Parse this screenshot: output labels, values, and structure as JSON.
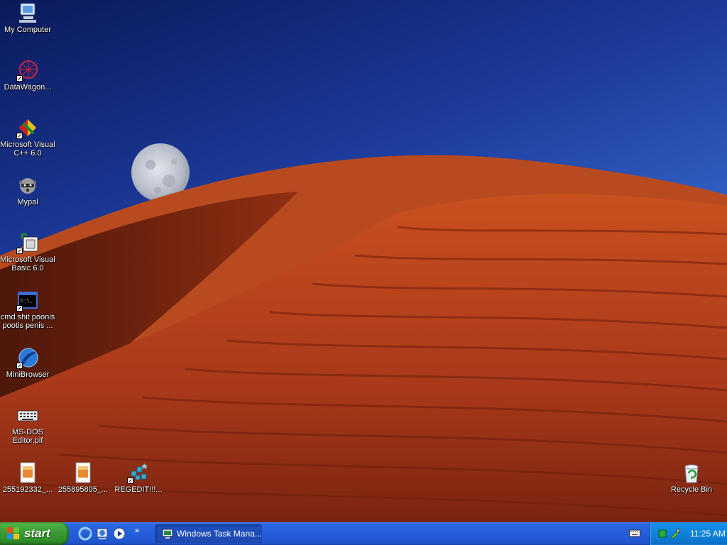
{
  "desktop": {
    "icons": [
      {
        "label": "My Computer",
        "icon": "my-computer-icon"
      },
      {
        "label": "DataWagon...",
        "icon": "datawagon-icon"
      },
      {
        "label": "Microsoft Visual C++ 6.0",
        "icon": "visual-cpp-icon"
      },
      {
        "label": "Mypal",
        "icon": "mypal-raccoon-icon"
      },
      {
        "label": "Microsoft Visual Basic 6.0",
        "icon": "visual-basic-icon"
      },
      {
        "label": "cmd shit poonis pootis penis ...",
        "icon": "cmd-icon"
      },
      {
        "label": "MiniBrowser",
        "icon": "minibrowser-icon"
      },
      {
        "label": "MS-DOS Editor.pif",
        "icon": "keyboard-icon"
      },
      {
        "label": "255192332_...",
        "icon": "image-file-icon"
      },
      {
        "label": "255895805_...",
        "icon": "image-file-icon"
      },
      {
        "label": "REGEDIT!!!...",
        "icon": "regedit-icon"
      },
      {
        "label": "Recycle Bin",
        "icon": "recycle-bin-icon"
      }
    ]
  },
  "taskbar": {
    "start_label": "start",
    "quick_launch": [
      "ie-swirl-icon",
      "show-desktop-icon",
      "media-player-icon"
    ],
    "overflow": "»",
    "task_button_label": "Windows Task Mana...",
    "clock": "11:25 AM"
  },
  "colors": {
    "taskbar_blue": "#245edb",
    "start_green": "#3c9d36",
    "tray_blue": "#0f82dc",
    "dune_red": "#b8401c"
  }
}
